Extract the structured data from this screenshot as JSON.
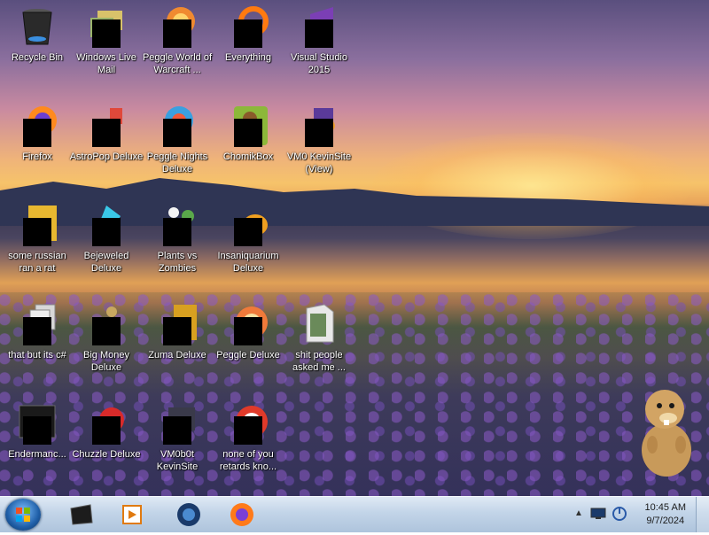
{
  "desktop_icons": [
    {
      "label": "Recycle Bin",
      "name": "recycle-bin-icon",
      "covered": false
    },
    {
      "label": "Windows Live Mail",
      "name": "windows-live-mail-icon",
      "covered": true
    },
    {
      "label": "Peggle World of Warcraft ...",
      "name": "peggle-wow-icon",
      "covered": true
    },
    {
      "label": "Everything",
      "name": "everything-icon",
      "covered": true
    },
    {
      "label": "Visual Studio 2015",
      "name": "visual-studio-icon",
      "covered": true
    },
    {
      "label": "Firefox",
      "name": "firefox-icon",
      "covered": true
    },
    {
      "label": "AstroPop Deluxe",
      "name": "astropop-icon",
      "covered": true
    },
    {
      "label": "Peggle Nights Deluxe",
      "name": "peggle-nights-icon",
      "covered": true
    },
    {
      "label": "ChomikBox",
      "name": "chomikbox-icon",
      "covered": true
    },
    {
      "label": "VM0 KevinSite (View)",
      "name": "vm0-kevinsite-icon",
      "covered": true
    },
    {
      "label": "some russian ran a rat",
      "name": "russian-rat-icon",
      "covered": true
    },
    {
      "label": "Bejeweled Deluxe",
      "name": "bejeweled-icon",
      "covered": true
    },
    {
      "label": "Plants vs Zombies",
      "name": "plants-vs-zombies-icon",
      "covered": true
    },
    {
      "label": "Insaniquarium Deluxe",
      "name": "insaniquarium-icon",
      "covered": true
    },
    {
      "label": "that but its c#",
      "name": "that-but-csharp-icon",
      "covered": true
    },
    {
      "label": "Big Money Deluxe",
      "name": "big-money-icon",
      "covered": true
    },
    {
      "label": "Zuma Deluxe",
      "name": "zuma-icon",
      "covered": true
    },
    {
      "label": "Peggle Deluxe",
      "name": "peggle-deluxe-icon",
      "covered": true
    },
    {
      "label": "shit people asked me ...",
      "name": "folder-icon",
      "covered": false
    },
    {
      "label": "Endermanc...",
      "name": "endermanch-icon",
      "covered": true
    },
    {
      "label": "Chuzzle Deluxe",
      "name": "chuzzle-icon",
      "covered": true
    },
    {
      "label": "VM0b0t KevinSite",
      "name": "vm0b0t-kevinsite-icon",
      "covered": true
    },
    {
      "label": "none of you retards kno...",
      "name": "none-of-you-icon",
      "covered": true
    }
  ],
  "taskbar": {
    "start_icon": "windows-orb-icon",
    "pinned": [
      {
        "name": "terminal-app-icon"
      },
      {
        "name": "media-player-icon"
      },
      {
        "name": "globe-app-icon"
      },
      {
        "name": "firefox-taskbar-icon"
      }
    ]
  },
  "tray": {
    "time": "10:45 AM",
    "date": "9/7/2024"
  },
  "colors": {
    "taskbar_top": "#dfe9f4",
    "taskbar_bottom": "#aec4dc",
    "label_text": "#ffffff"
  }
}
